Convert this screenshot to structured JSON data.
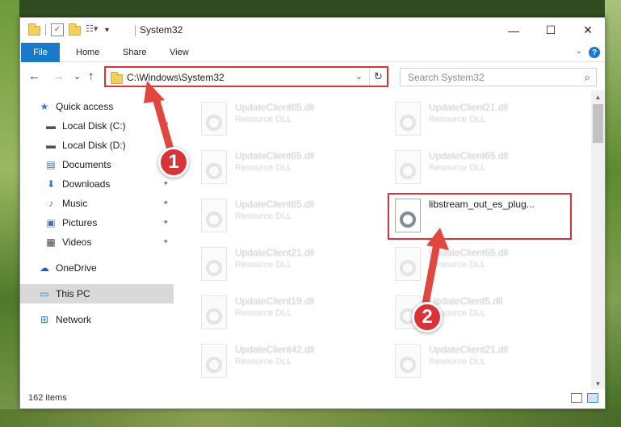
{
  "window": {
    "title": "System32",
    "minimize_glyph": "—",
    "maximize_glyph": "☐",
    "close_glyph": "✕"
  },
  "ribbon": {
    "file": "File",
    "home": "Home",
    "share": "Share",
    "view": "View",
    "help_glyph": "?"
  },
  "nav": {
    "back_glyph": "←",
    "forward_glyph": "→",
    "recent_glyph": "⌄",
    "up_glyph": "↑",
    "address": "C:\\Windows\\System32",
    "address_chevron": "⌄",
    "refresh_glyph": "↻",
    "search_placeholder": "Search System32",
    "search_glyph": "⌕"
  },
  "sidebar": {
    "items": [
      {
        "label": "Quick access",
        "icon": "star-icon",
        "glyph": "★",
        "color": "#2b7bd6"
      },
      {
        "label": "Local Disk (C:)",
        "icon": "drive-icon",
        "glyph": "▬",
        "color": "#555555"
      },
      {
        "label": "Local Disk (D:)",
        "icon": "drive-icon",
        "glyph": "▬",
        "color": "#555555"
      },
      {
        "label": "Documents",
        "icon": "documents-icon",
        "glyph": "▤",
        "color": "#4a6fa5"
      },
      {
        "label": "Downloads",
        "icon": "download-icon",
        "glyph": "⬇",
        "color": "#2b7bd6"
      },
      {
        "label": "Music",
        "icon": "music-icon",
        "glyph": "♪",
        "color": "#2b7bd6"
      },
      {
        "label": "Pictures",
        "icon": "pictures-icon",
        "glyph": "▣",
        "color": "#4a6fa5"
      },
      {
        "label": "Videos",
        "icon": "video-icon",
        "glyph": "▦",
        "color": "#444444"
      },
      {
        "label": "OneDrive",
        "icon": "cloud-icon",
        "glyph": "☁",
        "color": "#1e62b5"
      },
      {
        "label": "This PC",
        "icon": "computer-icon",
        "glyph": "▭",
        "color": "#2b7bd6"
      },
      {
        "label": "Network",
        "icon": "network-icon",
        "glyph": "⊞",
        "color": "#2b7bd6"
      }
    ]
  },
  "files": [
    {
      "name": "UpdateClient65.dll",
      "type": "Resource DLL"
    },
    {
      "name": "UpdateClient21.dll",
      "type": "Resource DLL"
    },
    {
      "name": "UpdateClient65.dll",
      "type": "Resource DLL"
    },
    {
      "name": "UpdateClient65.dll",
      "type": "Resource DLL"
    },
    {
      "name": "UpdateClient65.dll",
      "type": "Resource DLL"
    },
    {
      "name": "libstream_out_es_plug...",
      "type": ""
    },
    {
      "name": "UpdateClient21.dll",
      "type": "Resource DLL"
    },
    {
      "name": "UpdateClient65.dll",
      "type": "Resource DLL"
    },
    {
      "name": "UpdateClient19.dll",
      "type": "Resource DLL"
    },
    {
      "name": "UpdateClient5.dll",
      "type": "Resource DLL"
    },
    {
      "name": "UpdateClient42.dll",
      "type": "Resource DLL"
    },
    {
      "name": "UpdateClient21.dll",
      "type": "Resource DLL"
    }
  ],
  "status": {
    "item_count": "162 items"
  },
  "annotations": {
    "step1": "1",
    "step2": "2",
    "color": "#d9333a"
  }
}
